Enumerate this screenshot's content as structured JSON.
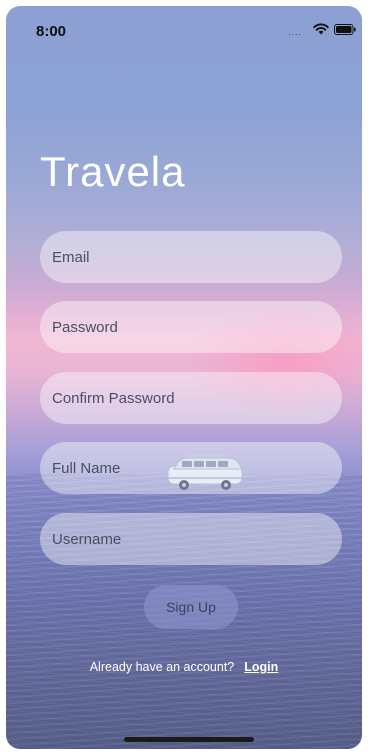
{
  "status_bar": {
    "time": "8:00",
    "signal": "....",
    "icons": [
      "wifi-icon",
      "battery-icon"
    ]
  },
  "app": {
    "title": "Travela"
  },
  "form": {
    "fields": [
      {
        "placeholder": "Email"
      },
      {
        "placeholder": "Password"
      },
      {
        "placeholder": "Confirm Password"
      },
      {
        "placeholder": "Full Name"
      },
      {
        "placeholder": "Username"
      }
    ],
    "submit_label": "Sign Up"
  },
  "footer": {
    "prompt": "Already have an account?",
    "login_label": "Login"
  },
  "colors": {
    "field_bg": "rgba(255,255,255,0.42)",
    "text": "#ffffff",
    "button_bg": "#8c96cd"
  }
}
